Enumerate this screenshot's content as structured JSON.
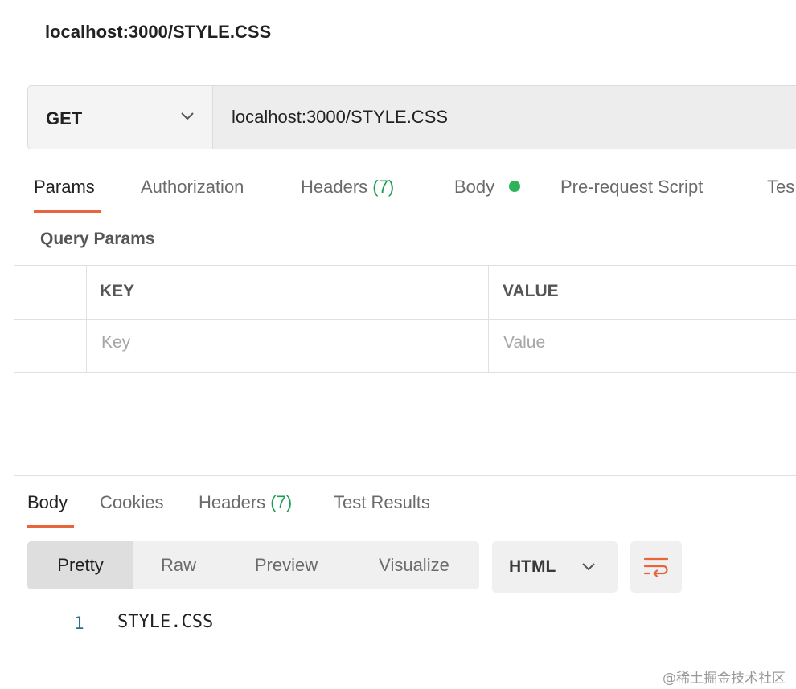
{
  "title_bar": {
    "title": "localhost:3000/STYLE.CSS"
  },
  "request": {
    "method": "GET",
    "url": "localhost:3000/STYLE.CSS"
  },
  "request_tabs": {
    "params": "Params",
    "authorization": "Authorization",
    "headers": "Headers",
    "headers_count": "(7)",
    "body": "Body",
    "pre_request": "Pre-request Script",
    "tests": "Tes"
  },
  "query_params": {
    "title": "Query Params",
    "columns": [
      "KEY",
      "VALUE"
    ],
    "placeholders": [
      "Key",
      "Value"
    ]
  },
  "response_tabs": {
    "body": "Body",
    "cookies": "Cookies",
    "headers": "Headers",
    "headers_count": "(7)",
    "test_results": "Test Results"
  },
  "format_options": [
    "Pretty",
    "Raw",
    "Preview",
    "Visualize"
  ],
  "language": "HTML",
  "code": {
    "line_number": "1",
    "text": "STYLE.CSS"
  },
  "watermark": "@稀土掘金技术社区",
  "colors": {
    "accent": "#e8643a",
    "count_green": "#1f9d55",
    "dot_green": "#2fb35a"
  }
}
